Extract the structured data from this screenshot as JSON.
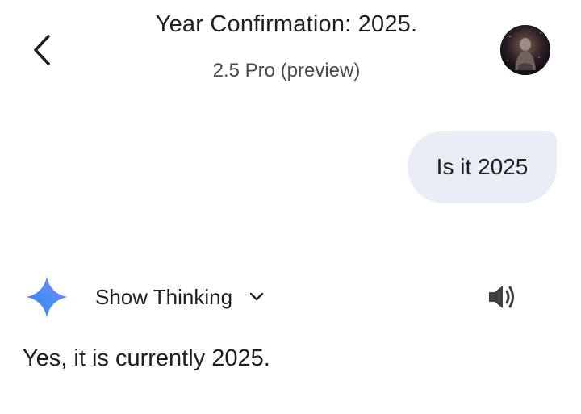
{
  "header": {
    "title": "Year Confirmation: 2025.",
    "subtitle": "2.5 Pro (preview)",
    "back_icon": "chevron-left-icon",
    "avatar_icon": "user-avatar"
  },
  "conversation": {
    "user_message": "Is it 2025",
    "model": {
      "logo_icon": "gemini-star-icon",
      "show_thinking_label": "Show Thinking",
      "show_thinking_icon": "chevron-down-icon",
      "speaker_icon": "speaker-icon",
      "response": "Yes, it is currently 2025."
    }
  },
  "colors": {
    "user_bubble_bg": "#e9eef6",
    "text": "#1f1f1f",
    "subtitle": "#4a4a4a",
    "gemini_blue": "#4f8df5",
    "gemini_purple": "#9b72f2"
  }
}
